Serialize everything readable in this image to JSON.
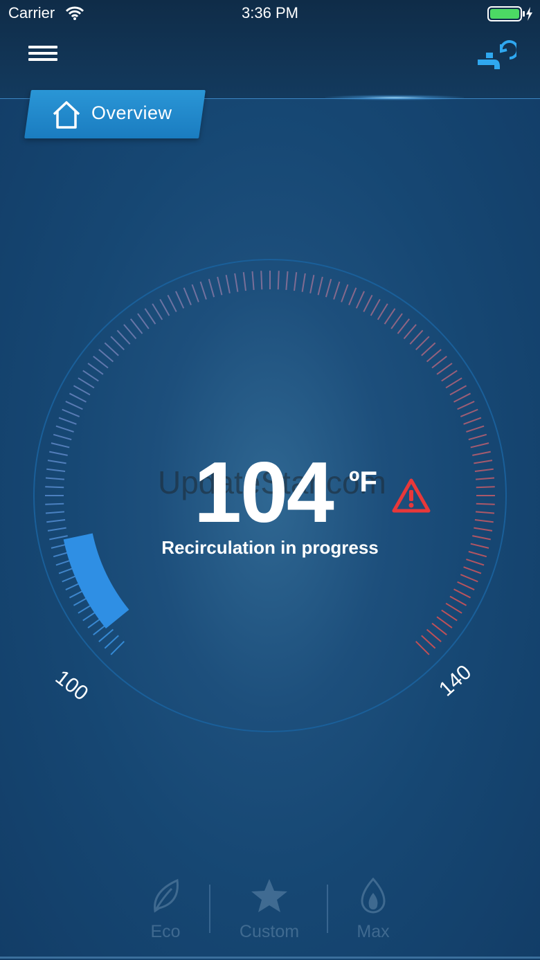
{
  "status_bar": {
    "carrier": "Carrier",
    "time": "3:36 PM"
  },
  "header": {
    "tab_label": "Overview"
  },
  "dial": {
    "temperature": "104",
    "unit": "ºF",
    "status": "Recirculation in progress",
    "min_label": "100",
    "max_label": "140",
    "setpoint_fraction": 0.1,
    "colors": {
      "cold": "#3a96e6",
      "hot": "#e0504f",
      "indicator": "#2f8fe4",
      "warning": "#e8383a"
    }
  },
  "watermark": "UpdateStar.com",
  "modes": [
    {
      "label": "Eco",
      "icon": "leaf-icon"
    },
    {
      "label": "Custom",
      "icon": "star-icon"
    },
    {
      "label": "Max",
      "icon": "flame-icon"
    }
  ]
}
